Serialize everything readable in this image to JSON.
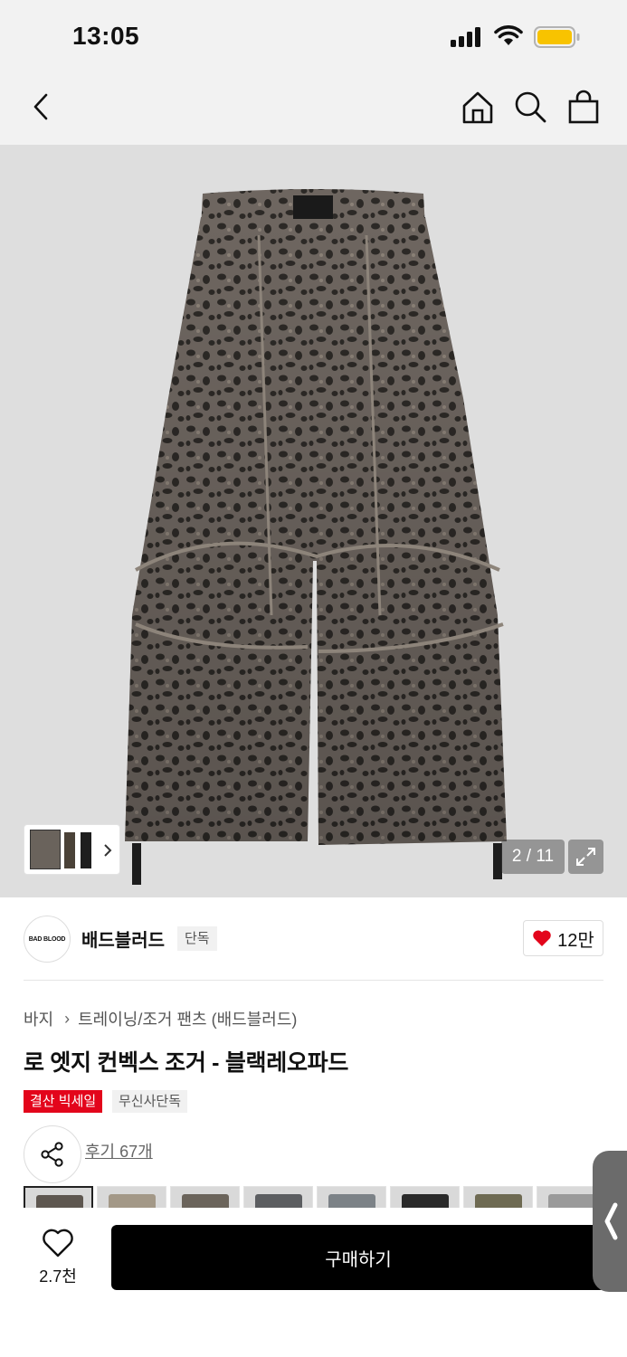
{
  "status_bar": {
    "time": "13:05"
  },
  "nav": {
    "icons": [
      "back-icon",
      "home-icon",
      "search-icon",
      "shopping-bag-icon"
    ]
  },
  "gallery": {
    "counter": "2 / 11"
  },
  "brand": {
    "logo_text": "BAD BLOOD",
    "name": "배드블러드",
    "badge": "단독",
    "likes": "12만"
  },
  "product": {
    "breadcrumb": [
      "바지",
      "트레이닝/조거 팬츠 (배드블러드)"
    ],
    "title": "로 엣지 컨벡스 조거 - 블랙레오파드",
    "tags": {
      "sale": "결산 빅세일",
      "exclusive": "무신사단독"
    },
    "reviews": "후기 67개"
  },
  "bottom_bar": {
    "wishlist_count": "2.7천",
    "buy_label": "구매하기"
  },
  "colors": {
    "accent_red": "#e3051b",
    "buy_button": "#000000",
    "heart": "#e3051b"
  }
}
